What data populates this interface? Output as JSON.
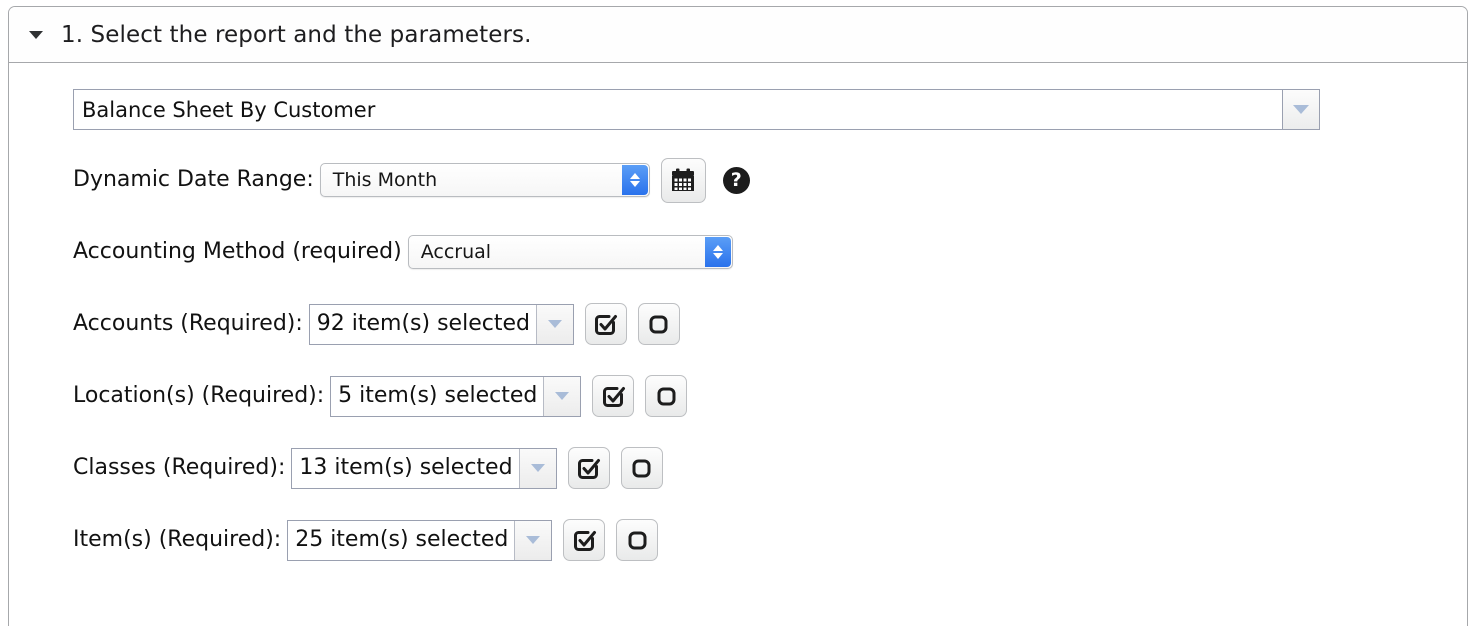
{
  "panel": {
    "title": "1. Select the report and the parameters.",
    "collapse_icon": "triangle-down-icon"
  },
  "report": {
    "value": "Balance Sheet By Customer",
    "dropdown_icon": "triangle-down-icon"
  },
  "fields": [
    {
      "label": "Dynamic Date Range:",
      "type": "select",
      "value": "This Month",
      "stepper_icon": "chevron-updown-icon",
      "calendar_icon": "calendar-icon",
      "help_icon": "question-mark-icon",
      "help_glyph": "?"
    },
    {
      "label": "Accounting Method (required)",
      "type": "select",
      "value": "Accrual",
      "stepper_icon": "chevron-updown-icon"
    },
    {
      "label": "Accounts (Required):",
      "type": "multiselect",
      "value": "92 item(s) selected",
      "dropdown_icon": "triangle-down-icon",
      "select_all_icon": "checked-box-icon",
      "clear_all_icon": "empty-box-icon"
    },
    {
      "label": "Location(s) (Required):",
      "type": "multiselect",
      "value": "5 item(s) selected",
      "dropdown_icon": "triangle-down-icon",
      "select_all_icon": "checked-box-icon",
      "clear_all_icon": "empty-box-icon"
    },
    {
      "label": "Classes (Required):",
      "type": "multiselect",
      "value": "13 item(s) selected",
      "dropdown_icon": "triangle-down-icon",
      "select_all_icon": "checked-box-icon",
      "clear_all_icon": "empty-box-icon"
    },
    {
      "label": "Item(s) (Required):",
      "type": "multiselect",
      "value": "25 item(s) selected",
      "dropdown_icon": "triangle-down-icon",
      "select_all_icon": "checked-box-icon",
      "clear_all_icon": "empty-box-icon"
    }
  ],
  "colors": {
    "panel_border": "#a6a8ab",
    "input_border": "#9aa0b0",
    "select_accent": "#2a72ec",
    "triangle_blue": "#a9bcd8",
    "text": "#121212"
  }
}
